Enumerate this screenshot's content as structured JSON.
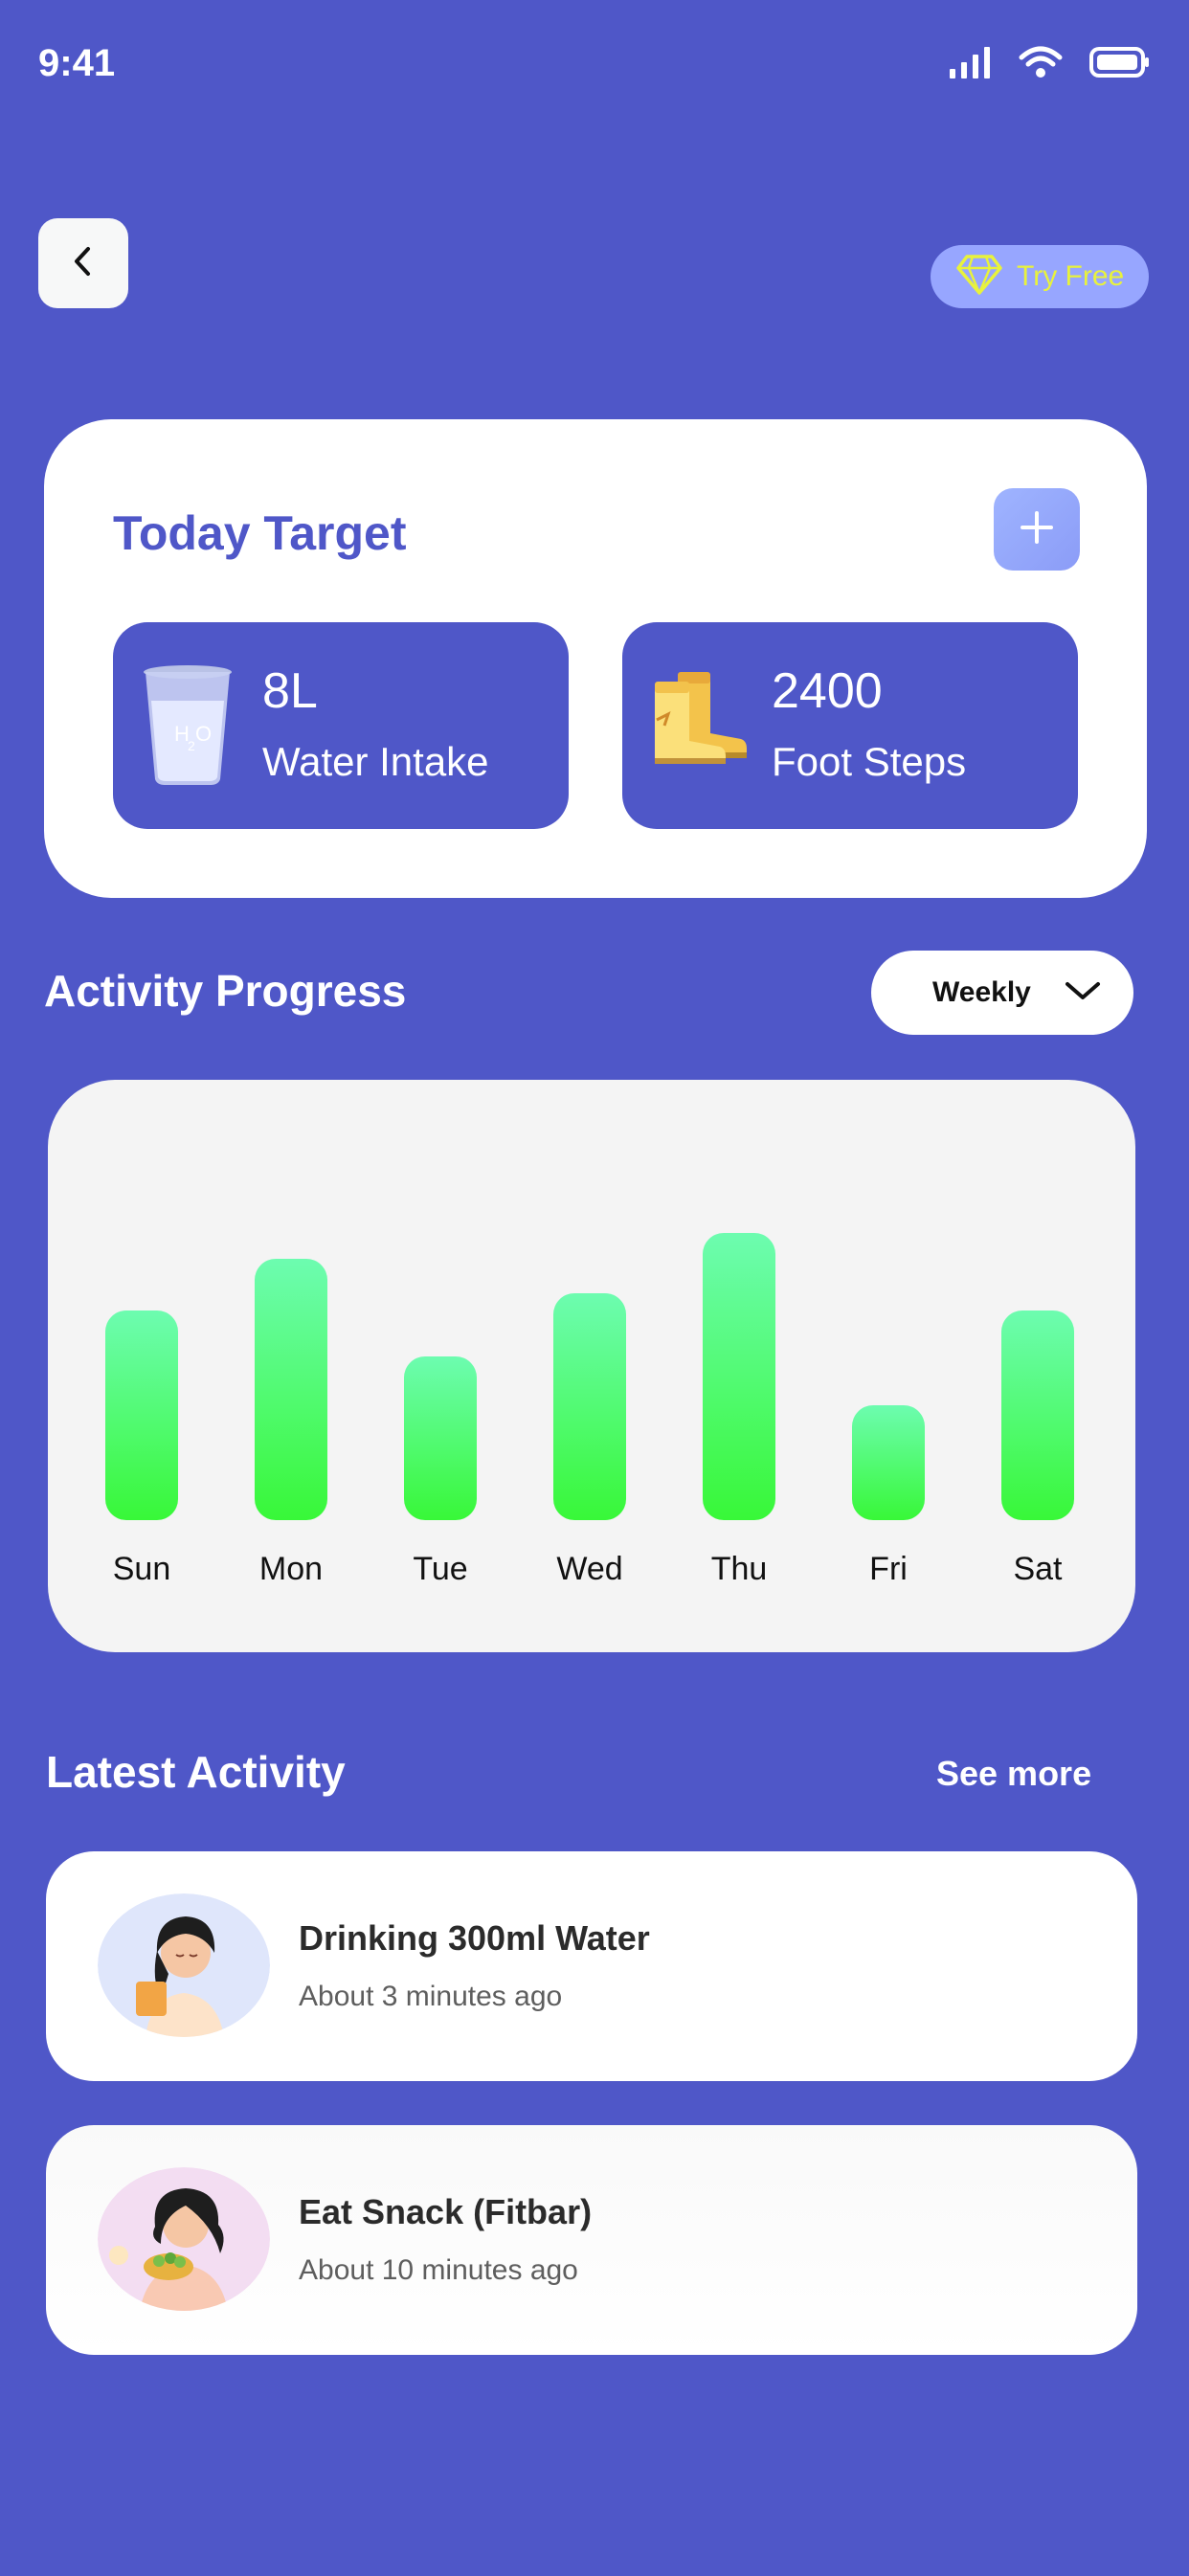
{
  "status_bar": {
    "time": "9:41",
    "icons": [
      "signal-icon",
      "wifi-icon",
      "battery-icon"
    ]
  },
  "nav": {
    "back_icon": "chevron-left-icon",
    "try_free_label": "Try Free",
    "try_free_icon": "diamond-icon"
  },
  "today_target": {
    "title": "Today Target",
    "add_icon": "plus-icon",
    "tiles": [
      {
        "value": "8L",
        "label": "Water Intake",
        "icon": "water-glass-icon"
      },
      {
        "value": "2400",
        "label": "Foot Steps",
        "icon": "boots-icon"
      }
    ]
  },
  "activity_progress": {
    "title": "Activity Progress",
    "period_selected": "Weekly",
    "dropdown_icon": "chevron-down-icon"
  },
  "chart_data": {
    "type": "bar",
    "categories": [
      "Sun",
      "Mon",
      "Tue",
      "Wed",
      "Thu",
      "Fri",
      "Sat"
    ],
    "values": [
      0.73,
      0.91,
      0.57,
      0.79,
      1.0,
      0.4,
      0.73
    ],
    "title": "",
    "xlabel": "",
    "ylabel": "",
    "ylim": [
      0,
      1
    ],
    "grid": false,
    "colors": {
      "top": "#6dfcb0",
      "bottom": "#38f838"
    }
  },
  "latest_activity": {
    "title": "Latest Activity",
    "see_more_label": "See more",
    "items": [
      {
        "title": "Drinking 300ml Water",
        "time": "About 3 minutes ago",
        "avatar_icon": "woman-drinking-avatar"
      },
      {
        "title": "Eat Snack (Fitbar)",
        "time": "About 10 minutes ago",
        "avatar_icon": "woman-eating-avatar"
      }
    ]
  },
  "colors": {
    "background": "#4f57c8",
    "accent": "#4f57c8",
    "try_free_bg": "#97a6ff",
    "try_free_text": "#e8f23c"
  }
}
